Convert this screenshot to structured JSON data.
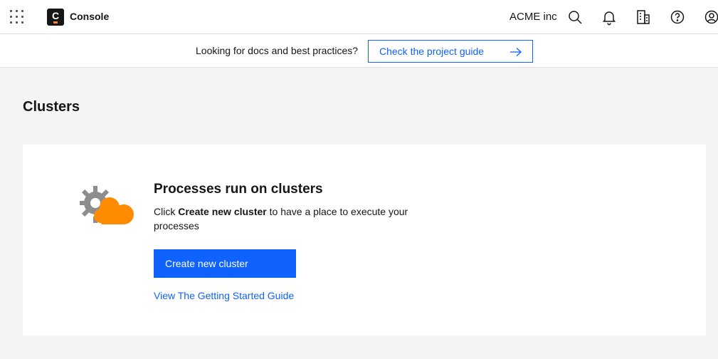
{
  "header": {
    "product_name": "Console",
    "logo_letter": "C",
    "org_name": "ACME inc",
    "icons": [
      "app-switcher-icon",
      "search-icon",
      "notification-icon",
      "building-icon",
      "help-icon",
      "user-avatar-icon"
    ]
  },
  "banner": {
    "text": "Looking for docs and best practices?",
    "button_label": "Check the project guide"
  },
  "page": {
    "title": "Clusters"
  },
  "empty_state": {
    "heading": "Processes run on clusters",
    "body_prefix": "Click ",
    "body_bold": "Create new cluster",
    "body_suffix": " to have a place to execute your processes",
    "primary_button": "Create new cluster",
    "link": "View The Getting Started Guide"
  },
  "colors": {
    "accent": "#0f62fe",
    "illustration_cloud": "#ff8c00",
    "illustration_gear": "#8d8d8d"
  }
}
